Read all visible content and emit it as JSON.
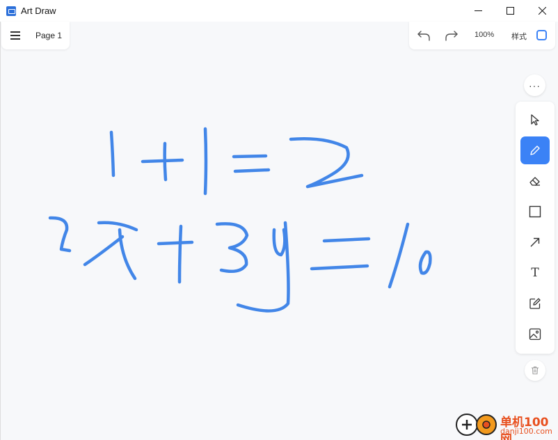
{
  "window": {
    "title": "Art Draw",
    "controls": [
      "minimize-icon",
      "maximize-icon",
      "close-icon"
    ]
  },
  "page": {
    "menu_icon": "menu-icon",
    "label": "Page 1"
  },
  "top_toolbar": {
    "undo_icon": "undo-icon",
    "redo_icon": "redo-icon",
    "zoom": "100%",
    "style_label": "样式",
    "style_color": "#3b82f6"
  },
  "more_button": "···",
  "side_toolbar": {
    "tools": [
      {
        "name": "select",
        "icon": "cursor-icon",
        "active": false
      },
      {
        "name": "pen",
        "icon": "pencil-icon",
        "active": true
      },
      {
        "name": "eraser",
        "icon": "eraser-icon",
        "active": false
      },
      {
        "name": "rectangle",
        "icon": "square-icon",
        "active": false
      },
      {
        "name": "arrow",
        "icon": "arrow-icon",
        "active": false
      },
      {
        "name": "text",
        "icon": "text-icon",
        "label": "T",
        "active": false
      },
      {
        "name": "note",
        "icon": "edit-note-icon",
        "active": false
      },
      {
        "name": "image",
        "icon": "image-icon",
        "active": false
      }
    ],
    "accent": "#3b82f6"
  },
  "delete_button": "trash-icon",
  "ink_color": "#4286e8",
  "watermark": {
    "text": "单机100网",
    "sub": "danji100.com"
  }
}
